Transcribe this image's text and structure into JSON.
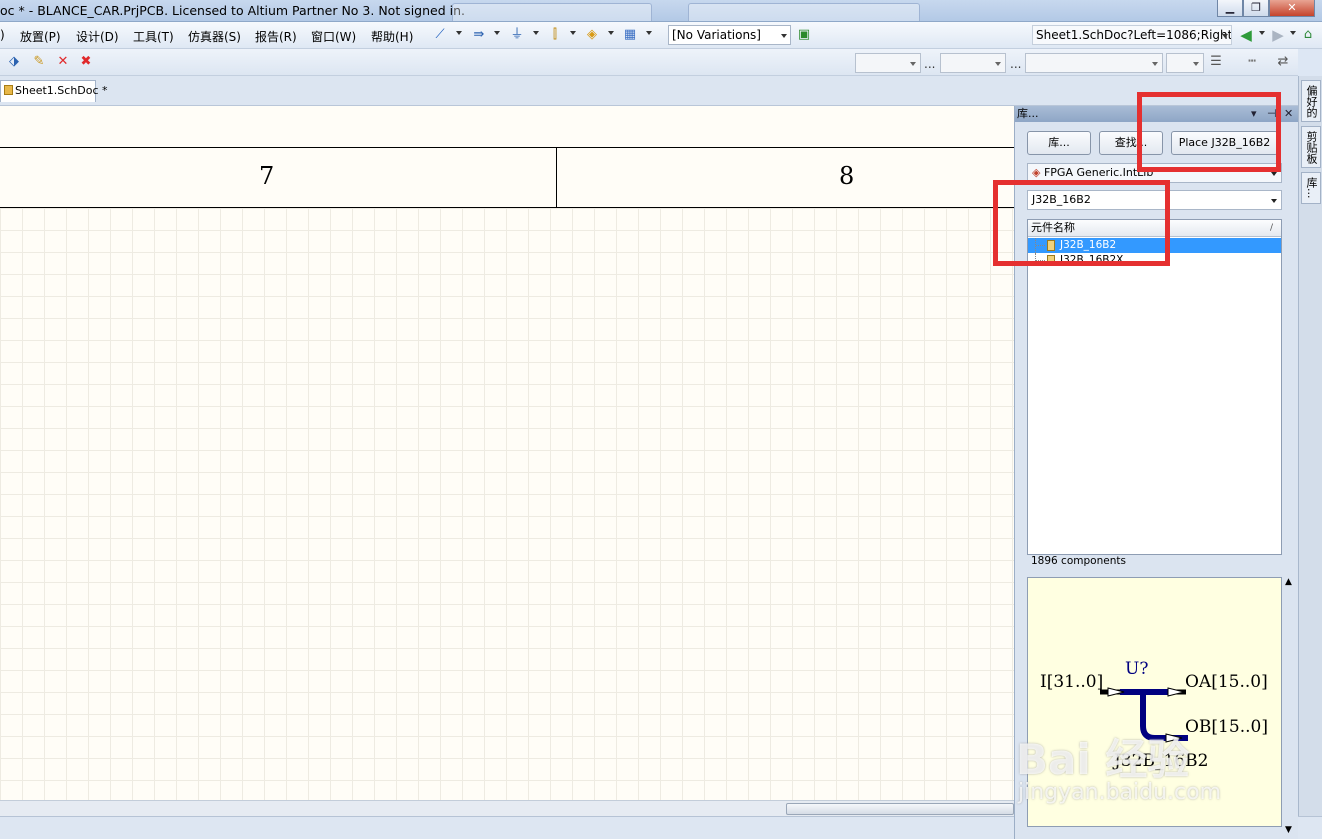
{
  "window": {
    "title": "oc * - BLANCE_CAR.PrjPCB. Licensed to Altium Partner No 3. Not signed in.",
    "minimize": "▁",
    "restore": "❐",
    "close": "✕"
  },
  "menu": {
    "items": [
      ")",
      "放置(P)",
      "设计(D)",
      "工具(T)",
      "仿真器(S)",
      "报告(R)",
      "窗口(W)",
      "帮助(H)"
    ],
    "variations": "[No Variations]",
    "location": "Sheet1.SchDoc?Left=1086;Right"
  },
  "toolbar2": {
    "dots": "..."
  },
  "doc_tab": {
    "label": "Sheet1.SchDoc *"
  },
  "sheet": {
    "zone_7": "7",
    "zone_8": "8"
  },
  "library_panel": {
    "title": "库...",
    "buttons": {
      "libraries": "库...",
      "search": "查找...",
      "place": "Place J32B_16B2"
    },
    "library_select": "FPGA Generic.IntLib",
    "filter_value": "J32B_16B2",
    "column_header": "元件名称",
    "sort_glyph": "/",
    "components": [
      {
        "name": "J32B_16B2",
        "selected": true
      },
      {
        "name": "J32B_16B2X",
        "selected": false
      }
    ],
    "count_text": "1896 components",
    "preview": {
      "designator": "U?",
      "input_pin": "I[31..0]",
      "output_a": "OA[15..0]",
      "output_b": "OB[15..0]",
      "part_name": "J32B_16B2"
    }
  },
  "dock_tabs": [
    "偏好的",
    "剪贴板",
    "库..."
  ],
  "watermark": {
    "logo": "Bai 经验",
    "url": "jingyan.baidu.com"
  },
  "colors": {
    "highlight": "#e53030",
    "selection": "#3399ff",
    "preview_bg": "#ffffe1",
    "wire": "#000080"
  }
}
